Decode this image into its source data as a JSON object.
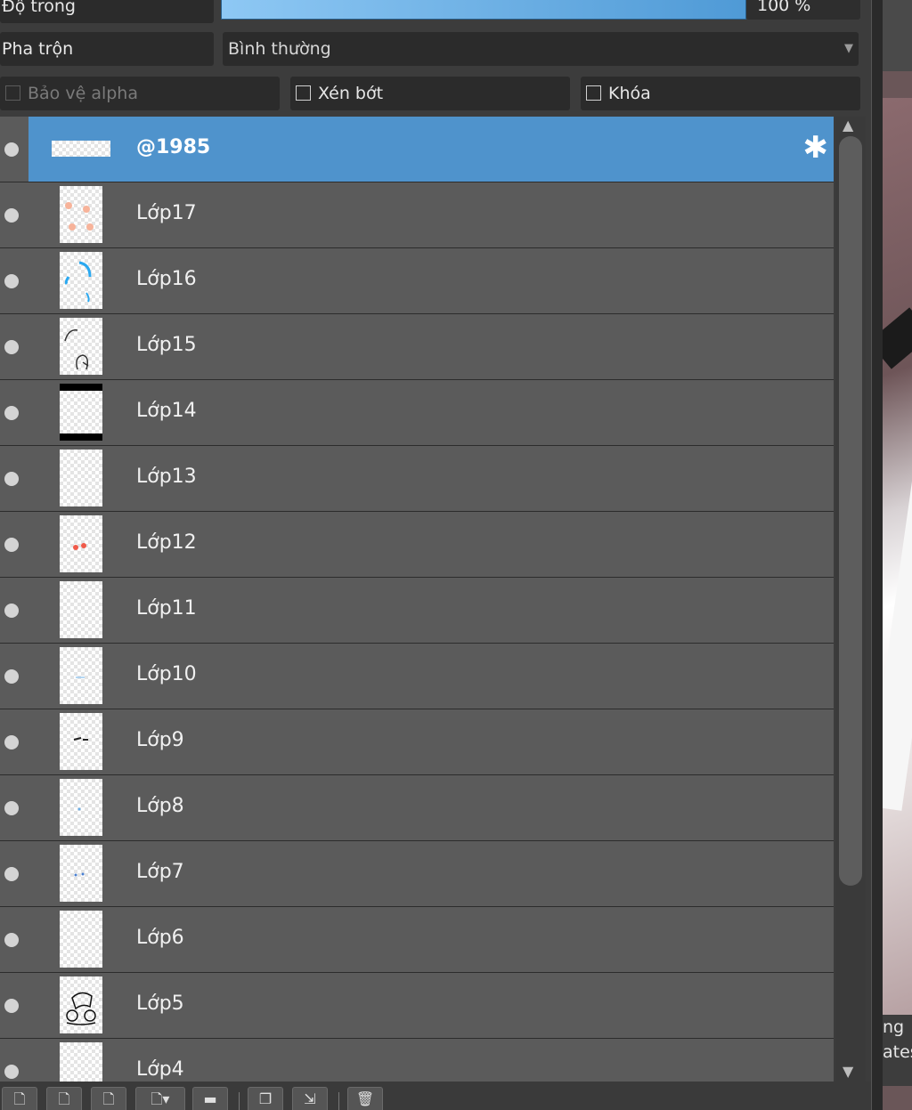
{
  "properties": {
    "opacity_label": "Độ trong",
    "opacity_value": "100 %",
    "opacity_fraction": 1.0,
    "blend_label": "Pha trộn",
    "blend_mode": "Bình thường"
  },
  "options": {
    "protect_alpha": "Bảo vệ alpha",
    "clip": "Xén bớt",
    "lock": "Khóa"
  },
  "layers": [
    {
      "name": "@1985",
      "selected": true
    },
    {
      "name": "Lớp17"
    },
    {
      "name": "Lớp16"
    },
    {
      "name": "Lớp15"
    },
    {
      "name": "Lớp14"
    },
    {
      "name": "Lớp13"
    },
    {
      "name": "Lớp12"
    },
    {
      "name": "Lớp11"
    },
    {
      "name": "Lớp10"
    },
    {
      "name": "Lớp9"
    },
    {
      "name": "Lớp8"
    },
    {
      "name": "Lớp7"
    },
    {
      "name": "Lớp6"
    },
    {
      "name": "Lớp5"
    },
    {
      "name": "Lớp4"
    }
  ],
  "canvas_caption": [
    "ng",
    "ates"
  ],
  "colors": {
    "selected_row": "#4f93cc",
    "row": "#5b5b5b",
    "opacity_bar": "#6aaee6"
  }
}
